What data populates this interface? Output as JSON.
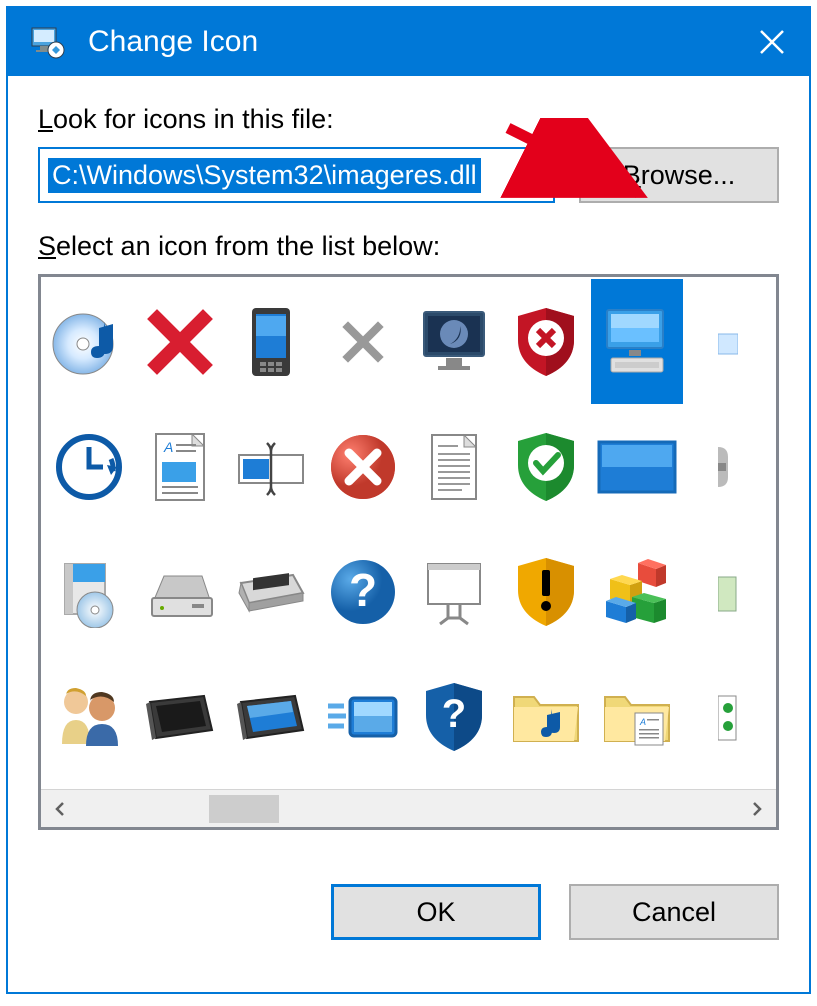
{
  "titlebar": {
    "text": "Change Icon"
  },
  "labels": {
    "look_for": {
      "prefix_u": "L",
      "rest": "ook for icons in this file:"
    },
    "select_list": {
      "prefix_u": "S",
      "rest": "elect an icon from the list below:"
    }
  },
  "path": {
    "value": "C:\\Windows\\System32\\imageres.dll"
  },
  "buttons": {
    "browse": {
      "prefix_u": "B",
      "rest": "rowse..."
    },
    "ok": "OK",
    "cancel": "Cancel"
  },
  "icons": [
    "disc-music",
    "red-x",
    "phone",
    "grey-x",
    "monitor-moon",
    "shield-red-x",
    "computer",
    "partial-a",
    "clock-arrow",
    "document-preview",
    "text-cursor",
    "red-circle-x",
    "document-lines",
    "shield-green-check",
    "widescreen",
    "gear-partial",
    "software-box",
    "removable-drive",
    "scanner",
    "blue-question",
    "whiteboard",
    "shield-yellow-warn",
    "blocks-3d",
    "partial-b",
    "users",
    "tablet-dark",
    "tablet-blue",
    "fast-panel",
    "shield-question",
    "folder-music",
    "folder-doc",
    "green-io"
  ],
  "selected_index": 6,
  "annotation": {
    "arrow_target": "browse-button"
  }
}
